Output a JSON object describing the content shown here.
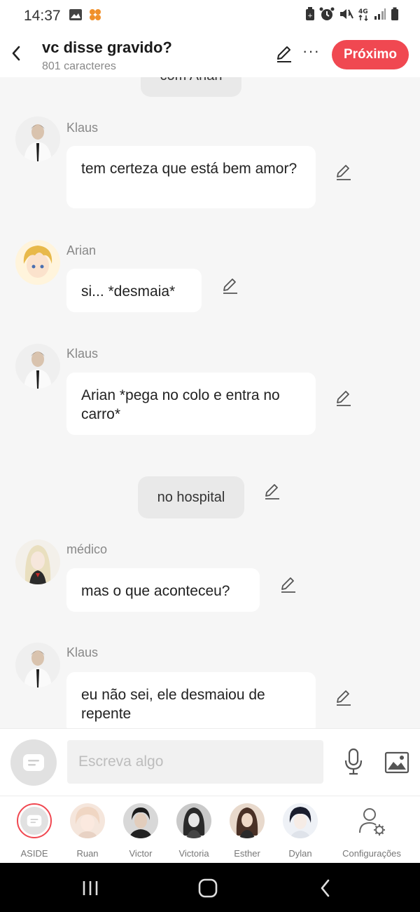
{
  "status_bar": {
    "time": "14:37",
    "icons": [
      "image-icon",
      "app-notification-icon",
      "battery-saver-icon",
      "alarm-icon",
      "mute-icon",
      "4g-icon",
      "signal-icon",
      "battery-icon"
    ]
  },
  "header": {
    "title": "vc disse gravido?",
    "subtitle": "801 caracteres",
    "next_label": "Próximo",
    "more_label": "···"
  },
  "chat": {
    "partial_narration": "com Arian",
    "messages": [
      {
        "type": "dialog",
        "speaker": "Klaus",
        "text": "tem certeza que está bem amor?"
      },
      {
        "type": "dialog",
        "speaker": "Arian",
        "text": "si... *desmaia*"
      },
      {
        "type": "dialog",
        "speaker": "Klaus",
        "text": "Arian *pega no colo e entra no carro*"
      },
      {
        "type": "narration",
        "text": "no hospital"
      },
      {
        "type": "dialog",
        "speaker": "médico",
        "text": "mas o que aconteceu?"
      },
      {
        "type": "dialog",
        "speaker": "Klaus",
        "text": "eu não sei, ele desmaiou de repente"
      }
    ]
  },
  "input": {
    "placeholder": "Escreva algo"
  },
  "characters": [
    {
      "label": "ASIDE"
    },
    {
      "label": "Ruan"
    },
    {
      "label": "Victor"
    },
    {
      "label": "Victoria"
    },
    {
      "label": "Esther"
    },
    {
      "label": "Dylan"
    },
    {
      "label": "Configurações"
    }
  ],
  "colors": {
    "accent": "#f04851",
    "background": "#f6f6f6",
    "bubble": "#ffffff",
    "narration": "#e9e9e9"
  }
}
